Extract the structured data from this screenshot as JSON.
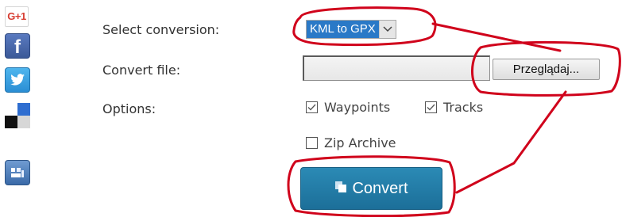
{
  "social": {
    "gplus_label": "G+1",
    "facebook_label": "f"
  },
  "form": {
    "select_conversion_label": "Select conversion:",
    "convert_file_label": "Convert file:",
    "options_label": "Options:",
    "conversion_value": "KML to GPX",
    "file_value": "",
    "browse_label": "Przeglądaj...",
    "options": {
      "waypoints": {
        "label": "Waypoints",
        "checked": true
      },
      "tracks": {
        "label": "Tracks",
        "checked": true
      },
      "zip": {
        "label": "Zip Archive",
        "checked": false
      }
    },
    "convert_label": "Convert"
  },
  "colors": {
    "annotation": "#d0021b",
    "convert_button": "#1f76a1",
    "select_highlight": "#2a79c7"
  }
}
